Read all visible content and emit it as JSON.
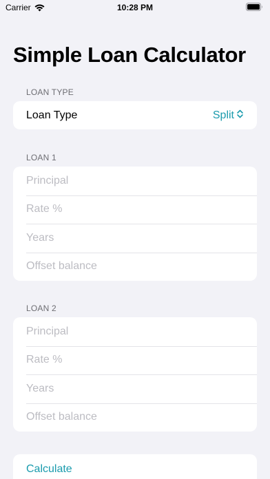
{
  "status_bar": {
    "carrier": "Carrier",
    "time": "10:28 PM"
  },
  "title": "Simple Loan Calculator",
  "loan_type": {
    "header": "LOAN TYPE",
    "label": "Loan Type",
    "value": "Split"
  },
  "loan1": {
    "header": "LOAN 1",
    "fields": [
      "Principal",
      "Rate %",
      "Years",
      "Offset balance"
    ]
  },
  "loan2": {
    "header": "LOAN 2",
    "fields": [
      "Principal",
      "Rate %",
      "Years",
      "Offset balance"
    ]
  },
  "calculate_label": "Calculate",
  "colors": {
    "accent": "#1a9bad",
    "background": "#f2f2f7",
    "placeholder": "#bcbcc2"
  },
  "icons": {
    "wifi": "wifi-icon",
    "battery": "battery-icon",
    "chevron": "chevron-up-down-icon"
  }
}
